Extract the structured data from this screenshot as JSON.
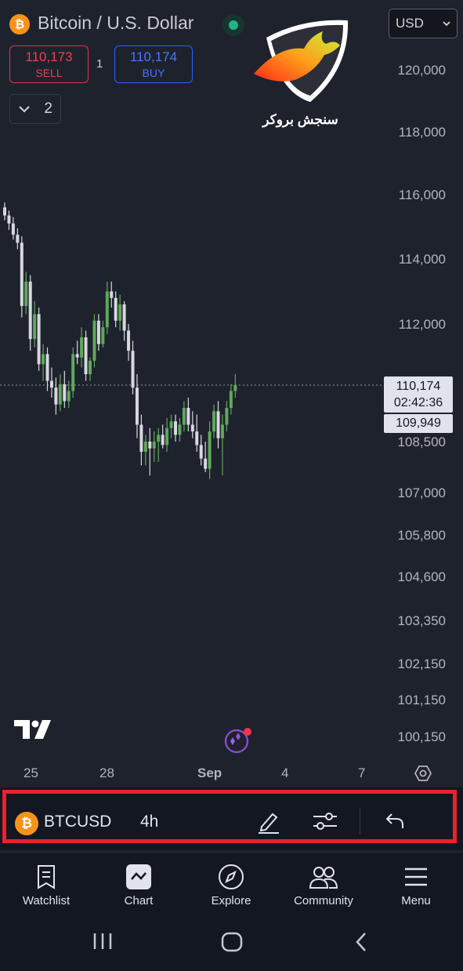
{
  "header": {
    "symbol_title": "Bitcoin / U.S. Dollar",
    "currency": "USD",
    "sell_price": "110,173",
    "sell_label": "SELL",
    "spread": "1",
    "buy_price": "110,174",
    "buy_label": "BUY",
    "indicator_count": "2"
  },
  "watermark": {
    "text": "سنجش بروکر"
  },
  "price_axis": [
    "120,000",
    "118,000",
    "116,000",
    "114,000",
    "112,000",
    "108,500",
    "107,000",
    "105,800",
    "104,600",
    "103,350",
    "102,150",
    "101,150",
    "100,150"
  ],
  "price_tag": {
    "last_price": "110,174",
    "countdown": "02:42:36",
    "secondary": "109,949"
  },
  "time_axis": [
    "25",
    "28",
    "Sep",
    "4",
    "7"
  ],
  "toolbar": {
    "symbol": "BTCUSD",
    "interval": "4h"
  },
  "bottom_nav": [
    {
      "label": "Watchlist",
      "icon": "watchlist-icon"
    },
    {
      "label": "Chart",
      "icon": "chart-icon"
    },
    {
      "label": "Explore",
      "icon": "compass-icon"
    },
    {
      "label": "Community",
      "icon": "community-icon"
    },
    {
      "label": "Menu",
      "icon": "menu-icon"
    }
  ],
  "chart_data": {
    "type": "candlestick",
    "colors": {
      "up": "#5fa85b",
      "down": "#d6d8de",
      "background": "#1e222d"
    },
    "candles": [
      [
        115600,
        115750,
        115200,
        115350
      ],
      [
        115350,
        115500,
        114900,
        115100
      ],
      [
        115100,
        115300,
        114600,
        114750
      ],
      [
        114750,
        114950,
        114300,
        114500
      ],
      [
        114500,
        114700,
        112200,
        112550
      ],
      [
        112550,
        113600,
        112300,
        113300
      ],
      [
        113300,
        113500,
        111200,
        111550
      ],
      [
        111550,
        112700,
        111300,
        112300
      ],
      [
        112300,
        112500,
        110600,
        110800
      ],
      [
        110800,
        111400,
        110300,
        111100
      ],
      [
        111100,
        111300,
        110000,
        110300
      ],
      [
        110300,
        110700,
        109800,
        110100
      ],
      [
        110100,
        110400,
        109300,
        109600
      ],
      [
        109600,
        110500,
        109400,
        110200
      ],
      [
        110200,
        110600,
        109500,
        109700
      ],
      [
        109700,
        110300,
        109500,
        110000
      ],
      [
        110000,
        111300,
        109800,
        111100
      ],
      [
        111100,
        111500,
        110800,
        111000
      ],
      [
        111000,
        111900,
        110700,
        111600
      ],
      [
        111600,
        111800,
        110300,
        110500
      ],
      [
        110500,
        111000,
        110300,
        110900
      ],
      [
        110900,
        112300,
        110700,
        112100
      ],
      [
        112100,
        112300,
        111200,
        111400
      ],
      [
        111400,
        112100,
        111300,
        111900
      ],
      [
        111900,
        113300,
        111700,
        113000
      ],
      [
        113000,
        113300,
        112500,
        112800
      ],
      [
        112800,
        113000,
        111900,
        112100
      ],
      [
        112100,
        112900,
        111800,
        112600
      ],
      [
        112600,
        112700,
        111500,
        111800
      ],
      [
        111800,
        112000,
        110900,
        111200
      ],
      [
        111200,
        111500,
        109900,
        110100
      ],
      [
        110100,
        110500,
        108600,
        109000
      ],
      [
        109000,
        109300,
        107800,
        108200
      ],
      [
        108200,
        108700,
        107800,
        108500
      ],
      [
        108500,
        108900,
        107500,
        108300
      ],
      [
        108300,
        108800,
        107900,
        108500
      ],
      [
        108500,
        108900,
        107900,
        108700
      ],
      [
        108700,
        109000,
        108300,
        108400
      ],
      [
        108400,
        109200,
        108200,
        108900
      ],
      [
        108900,
        109300,
        108600,
        109100
      ],
      [
        109100,
        109300,
        108500,
        108700
      ],
      [
        108700,
        109200,
        108500,
        109000
      ],
      [
        109000,
        109700,
        108800,
        109500
      ],
      [
        109500,
        109800,
        108800,
        109000
      ],
      [
        109000,
        109400,
        108600,
        108800
      ],
      [
        108800,
        109300,
        108200,
        108400
      ],
      [
        108400,
        108700,
        107800,
        108000
      ],
      [
        108000,
        108500,
        107600,
        107700
      ],
      [
        107700,
        109100,
        107400,
        108800
      ],
      [
        108800,
        109600,
        108600,
        109400
      ],
      [
        109400,
        109700,
        108300,
        108600
      ],
      [
        108600,
        109300,
        107500,
        109000
      ],
      [
        109000,
        109700,
        108800,
        109500
      ],
      [
        109500,
        110200,
        109300,
        110000
      ],
      [
        110000,
        110500,
        109800,
        110174
      ]
    ]
  }
}
